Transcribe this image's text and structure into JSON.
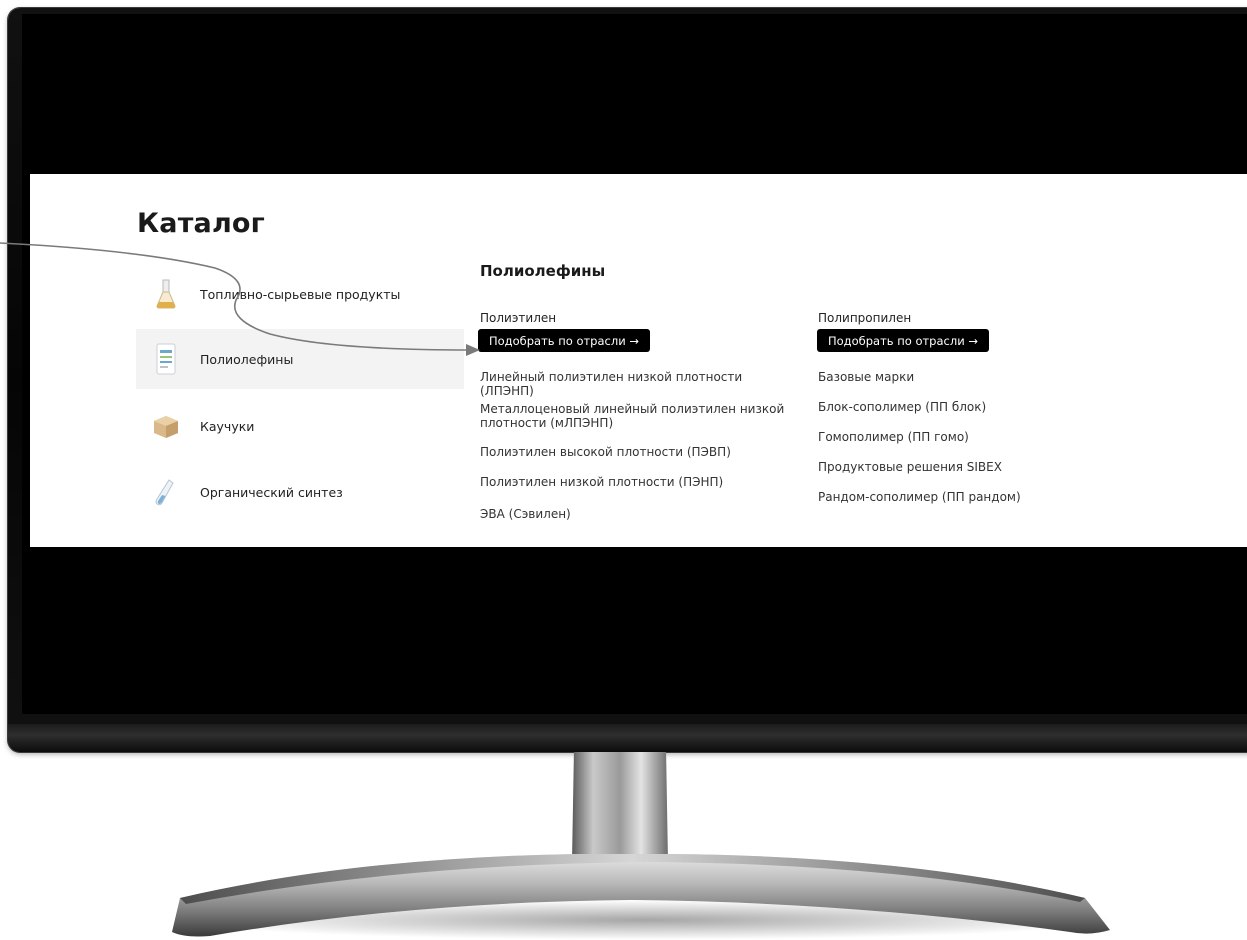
{
  "catalog": {
    "title": "Каталог",
    "categories": [
      {
        "label": "Топливно-сырьевые продукты",
        "icon": "flask-icon",
        "active": false
      },
      {
        "label": "Полиолефины",
        "icon": "granule-package-icon",
        "active": true
      },
      {
        "label": "Каучуки",
        "icon": "rubber-block-icon",
        "active": false
      },
      {
        "label": "Органический синтез",
        "icon": "test-tube-icon",
        "active": false
      }
    ],
    "section_title": "Полиолефины",
    "polyethylene": {
      "heading": "Полиэтилен",
      "button": "Подобрать по отрасли →",
      "items": [
        "Линейный полиэтилен низкой плотности (ЛПЭНП)",
        "Металлоценовый линейный полиэтилен низкой плотности (мЛПЭНП)",
        "Полиэтилен высокой плотности (ПЭВП)",
        "Полиэтилен низкой плотности (ПЭНП)",
        "ЭВА (Сэвилен)"
      ]
    },
    "polypropylene": {
      "heading": "Полипропилен",
      "button": "Подобрать по отрасли →",
      "items": [
        "Базовые марки",
        "Блок-сополимер (ПП блок)",
        "Гомополимер (ПП гомо)",
        "Продуктовые решения SIBEX",
        "Рандом-сополимер (ПП рандом)"
      ]
    }
  },
  "colors": {
    "button_bg": "#000000",
    "active_row_bg": "#f3f3f3",
    "annotation_line": "#777777"
  }
}
